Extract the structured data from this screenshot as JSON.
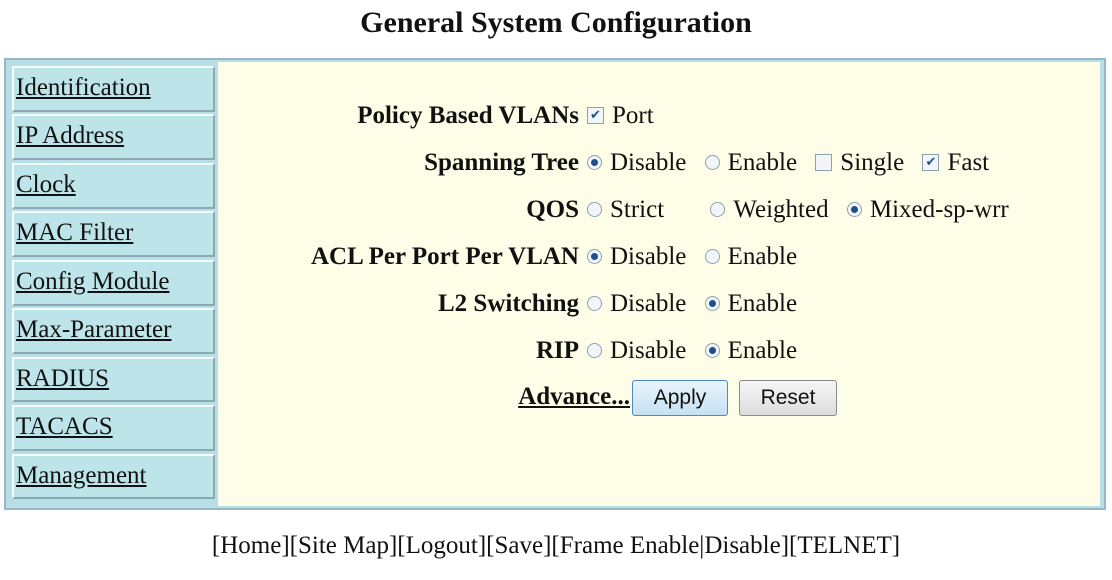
{
  "page": {
    "title": "General System Configuration"
  },
  "nav": {
    "items": [
      {
        "label": "Identification"
      },
      {
        "label": "IP Address"
      },
      {
        "label": "Clock"
      },
      {
        "label": "MAC Filter"
      },
      {
        "label": "Config Module"
      },
      {
        "label": "Max-Parameter"
      },
      {
        "label": "RADIUS"
      },
      {
        "label": "TACACS"
      },
      {
        "label": "Management"
      }
    ]
  },
  "form": {
    "policy_vlans": {
      "label": "Policy Based VLANs",
      "port_label": "Port",
      "port_checked": true
    },
    "spanning_tree": {
      "label": "Spanning Tree",
      "disable": "Disable",
      "enable": "Enable",
      "single": "Single",
      "fast": "Fast",
      "selected": "Disable",
      "single_checked": false,
      "fast_checked": true
    },
    "qos": {
      "label": "QOS",
      "strict": "Strict",
      "weighted": "Weighted",
      "mixed": "Mixed-sp-wrr",
      "selected": "Mixed-sp-wrr"
    },
    "acl": {
      "label": "ACL Per Port Per VLAN",
      "disable": "Disable",
      "enable": "Enable",
      "selected": "Disable"
    },
    "l2": {
      "label": "L2 Switching",
      "disable": "Disable",
      "enable": "Enable",
      "selected": "Enable"
    },
    "rip": {
      "label": "RIP",
      "disable": "Disable",
      "enable": "Enable",
      "selected": "Enable"
    },
    "advance_label": "Advance...",
    "apply_label": "Apply",
    "reset_label": "Reset"
  },
  "footer": {
    "links": [
      "Home",
      "Site Map",
      "Logout",
      "Save",
      "Frame Enable",
      "Disable",
      "TELNET"
    ]
  }
}
